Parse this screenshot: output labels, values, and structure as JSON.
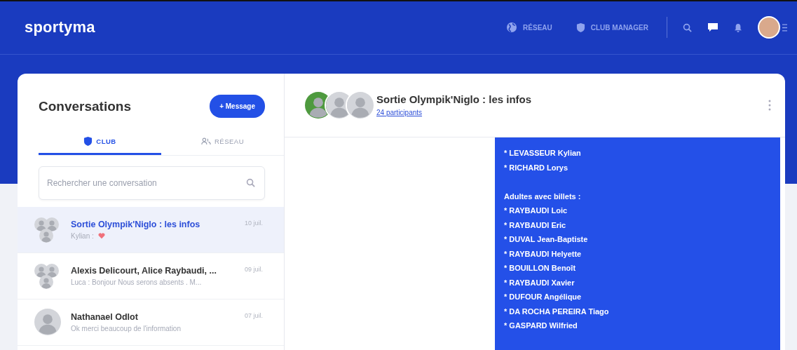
{
  "header": {
    "logo": "sportyma",
    "nav": [
      {
        "kind": "globe",
        "label": "RÉSEAU"
      },
      {
        "kind": "shield",
        "label": "CLUB MANAGER"
      }
    ]
  },
  "sidebar": {
    "title": "Conversations",
    "new_button": "+ Message",
    "tabs": [
      {
        "kind": "shield",
        "label": "CLUB",
        "selected": true
      },
      {
        "kind": "people",
        "label": "RÉSEAU",
        "selected": false
      }
    ],
    "search": {
      "placeholder": "Rechercher une conversation"
    },
    "conversations": [
      {
        "title": "Sortie Olympik'Niglo : les infos",
        "preview": "Kylian :",
        "date": "10 juil.",
        "selected": true,
        "kind": "group"
      },
      {
        "title": "Alexis Delicourt, Alice Raybaudi, ...",
        "preview": "Luca : Bonjour Nous serons absents . M...",
        "date": "09 juil.",
        "selected": false,
        "kind": "group"
      },
      {
        "title": "Nathanael Odlot",
        "preview": "Ok merci beaucoup de l'information",
        "date": "07 juil.",
        "selected": false,
        "kind": "single"
      }
    ]
  },
  "chat": {
    "title": "Sortie Olympik'Niglo : les infos",
    "participants": "24 participants",
    "message_lines": [
      "* LEVASSEUR Kylian",
      "* RICHARD Lorys",
      {
        "text": "Adultes avec billets :",
        "gap_before": true
      },
      "* RAYBAUDI Loic",
      "* RAYBAUDI Eric",
      "* DUVAL Jean-Baptiste",
      "* RAYBAUDI Helyette",
      "* BOUILLON Benoît",
      "* RAYBAUDI Xavier",
      "* DUFOUR Angélique",
      "* DA ROCHA PEREIRA Tiago",
      "* GASPARD Wilfried"
    ]
  }
}
